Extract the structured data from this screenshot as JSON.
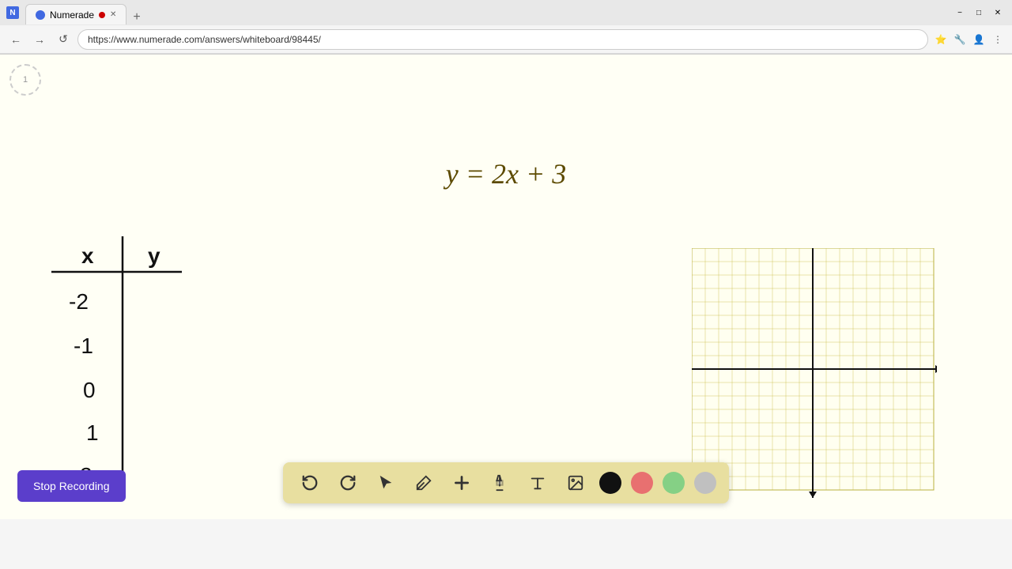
{
  "browser": {
    "tab_title": "Numerade",
    "tab_new_label": "+",
    "url": "https://www.numerade.com/answers/whiteboard/98445/",
    "nav": {
      "back": "←",
      "forward": "→",
      "refresh": "↺"
    },
    "window_controls": {
      "minimize": "−",
      "maximize": "□",
      "close": "✕"
    }
  },
  "whiteboard": {
    "formula": "y = 2x + 3",
    "timer_label": "1"
  },
  "toolbar": {
    "undo_label": "↩",
    "redo_label": "↪",
    "select_label": "▲",
    "pen_label": "/",
    "add_label": "+",
    "highlight_label": "✏",
    "text_label": "A",
    "image_label": "🖼",
    "colors": [
      "#111111",
      "#e87070",
      "#85d085",
      "#c0c0c0"
    ]
  },
  "stop_recording": {
    "label": "Stop Recording"
  },
  "xy_table": {
    "x_label": "x",
    "y_label": "y",
    "x_values": [
      "-2",
      "-1",
      "0",
      "1",
      "2"
    ]
  }
}
